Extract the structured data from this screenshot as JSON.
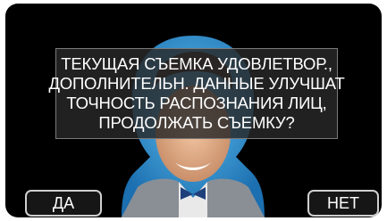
{
  "dialog": {
    "lines": [
      "ТЕКУЩАЯ СЪЕМКА УДОВЛЕТВОР.,",
      "ДОПОЛНИТЕЛЬН. ДАННЫЕ УЛУЧШАТ",
      "ТОЧНОСТЬ РАСПОЗНАНИЯ ЛИЦ,",
      "ПРОДОЛЖАТЬ СЪЕМКУ?"
    ]
  },
  "buttons": {
    "yes_label": "ДА",
    "no_label": "НЕТ"
  },
  "colors": {
    "screen_background": "#000000",
    "frame_blue": "#2a8fd0",
    "button_border": "#cfcfcf"
  }
}
